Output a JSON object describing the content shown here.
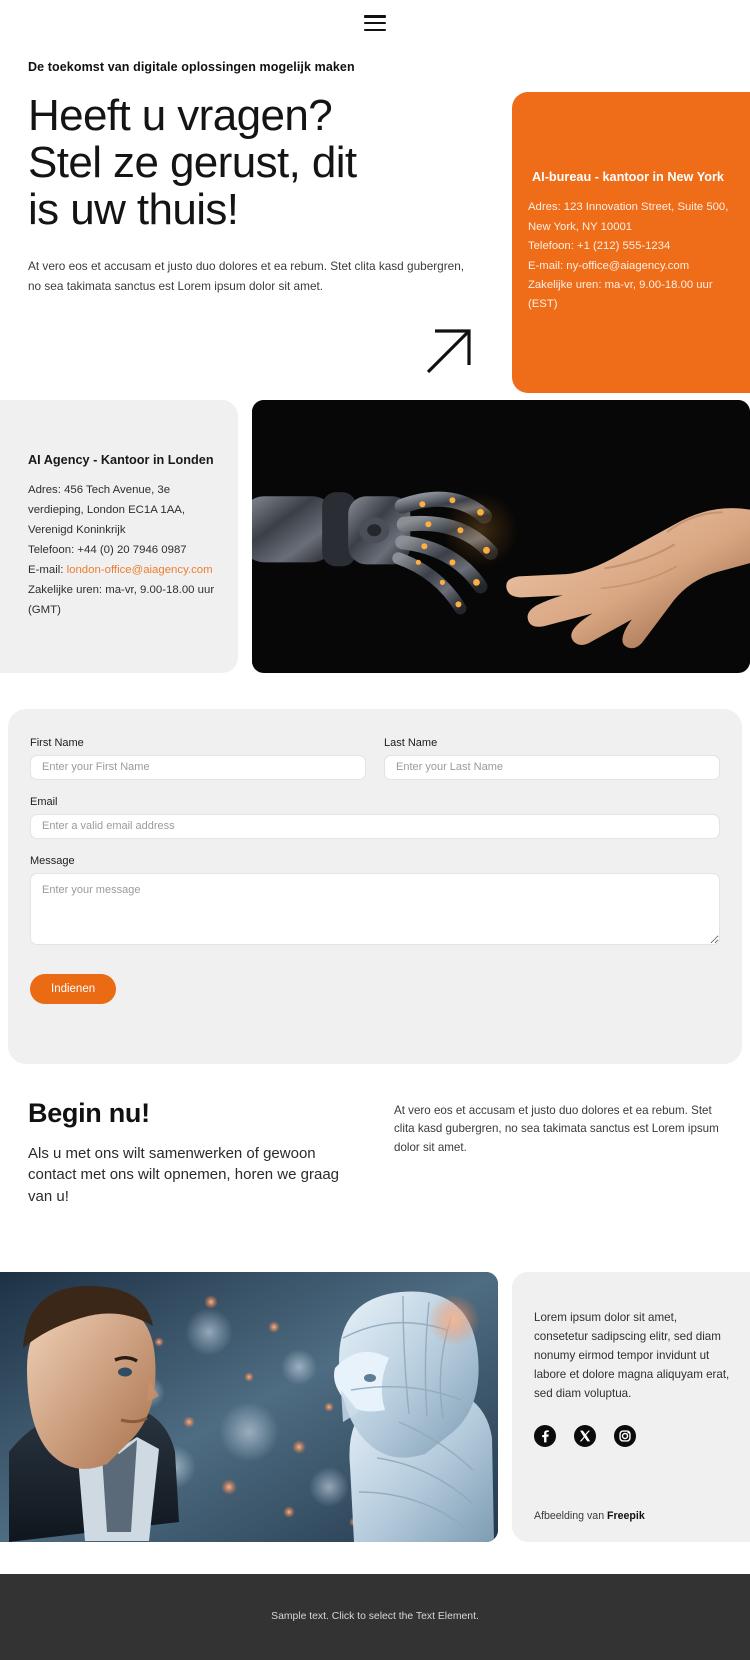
{
  "header": {
    "menu_icon": "hamburger-menu-icon"
  },
  "hero": {
    "eyebrow": "De toekomst van digitale oplossingen mogelijk maken",
    "title_line1": "Heeft u vragen?",
    "title_line2": "Stel ze gerust, dit",
    "title_line3": "is uw thuis!",
    "paragraph": "At vero eos et accusam et justo duo dolores et ea rebum. Stet clita kasd gubergren, no sea takimata sanctus est Lorem ipsum dolor sit amet.",
    "arrow_icon": "arrow-up-right-icon"
  },
  "new_york_office": {
    "title": "AI-bureau - kantoor in New York",
    "address_line1": "Adres: 123 Innovation Street, Suite 500,",
    "address_line2": "New York, NY 10001",
    "phone": "Telefoon: +1 (212) 555-1234",
    "email": "E-mail: ny-office@aiagency.com",
    "hours": "Zakelijke uren: ma-vr, 9.00-18.00 uur (EST)",
    "background_color": "#ef6c18"
  },
  "london_office": {
    "title": "AI Agency - Kantoor in Londen",
    "address_line1": "Adres: 456 Tech Avenue, 3e",
    "address_line2": "verdieping, London EC1A 1AA,",
    "address_line3": "Verenigd Koninkrijk",
    "phone": "Telefoon: +44 (0) 20 7946 0987",
    "email_label": "E-mail: ",
    "email_link": "london-office@aiagency.com",
    "email_link_color": "#ef7d2e",
    "hours_line1": "Zakelijke uren: ma-vr, 9.00-18.00 uur",
    "hours_line2": "(GMT)"
  },
  "robot_photo": {
    "alt": "robotic hand reaching toward human hand on black background"
  },
  "form": {
    "first_name": {
      "label": "First Name",
      "placeholder": "Enter your First Name",
      "value": ""
    },
    "last_name": {
      "label": "Last Name",
      "placeholder": "Enter your Last Name",
      "value": ""
    },
    "email": {
      "label": "Email",
      "placeholder": "Enter a valid email address",
      "value": ""
    },
    "message": {
      "label": "Message",
      "placeholder": "Enter your message",
      "value": ""
    },
    "submit_label": "Indienen",
    "submit_color": "#eb6a14"
  },
  "begin": {
    "title": "Begin nu!",
    "subtitle": "Als u met ons wilt samenwerken of gewoon contact met ons wilt opnemen, horen we graag van u!",
    "paragraph": "At vero eos et accusam et justo duo dolores et ea rebum. Stet clita kasd gubergren, no sea takimata sanctus est Lorem ipsum dolor sit amet."
  },
  "bottom_photo": {
    "alt": "businessman facing a humanoid robot with bokeh lights"
  },
  "social_card": {
    "text": "Lorem ipsum dolor sit amet, consetetur sadipscing elitr, sed diam nonumy eirmod tempor invidunt ut labore et dolore magna aliquyam erat, sed diam voluptua.",
    "icons": [
      "facebook-icon",
      "x-twitter-icon",
      "instagram-icon"
    ],
    "credit_prefix": "Afbeelding van ",
    "credit_source": "Freepik"
  },
  "footer": {
    "text": "Sample text. Click to select the Text Element."
  }
}
